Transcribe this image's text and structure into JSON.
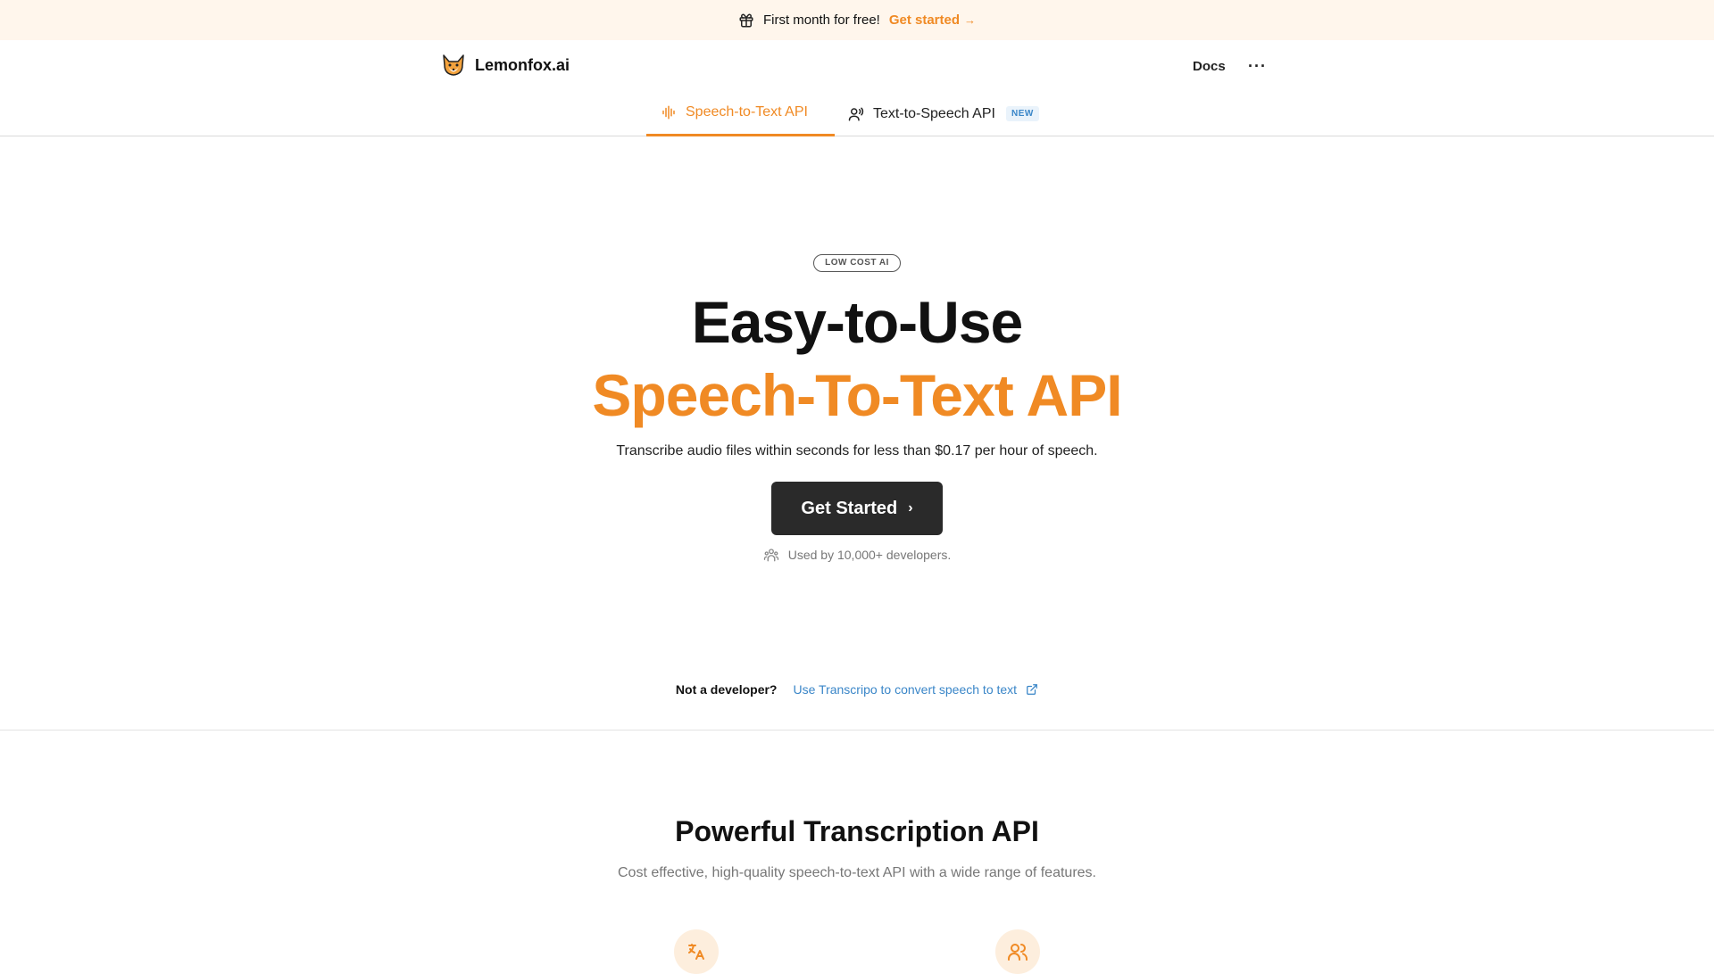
{
  "colors": {
    "accent": "#f08a24",
    "banner_bg": "#fff6ec",
    "link_blue": "#3a86c8",
    "cta_bg": "#2a2a2a"
  },
  "banner": {
    "icon": "gift-icon",
    "text": "First month for free!",
    "link": "Get started",
    "arrow": "→"
  },
  "header": {
    "brand_icon": "fox-logo-icon",
    "brand_name": "Lemonfox.ai",
    "docs": "Docs",
    "more": "···"
  },
  "tabs": [
    {
      "icon": "waveform-icon",
      "label": "Speech-to-Text API",
      "active": true
    },
    {
      "icon": "speaking-person-icon",
      "label": "Text-to-Speech API",
      "badge": "NEW",
      "active": false
    }
  ],
  "hero": {
    "pill": "LOW COST AI",
    "title_line1": "Easy-to-Use",
    "title_line2": "Speech-To-Text API",
    "subtitle": "Transcribe audio files within seconds for less than $0.17 per hour of speech.",
    "cta": "Get Started",
    "cta_chevron": "›",
    "used_by_icon": "users-icon",
    "used_by": "Used by 10,000+ developers."
  },
  "not_developer": {
    "question": "Not a developer?",
    "link": "Use Transcripo to convert speech to text",
    "link_icon": "external-link-icon"
  },
  "features": {
    "title": "Powerful Transcription API",
    "subtitle": "Cost effective, high-quality speech-to-text API with a wide range of features.",
    "icons": [
      "translate-icon",
      "users-icon"
    ]
  }
}
